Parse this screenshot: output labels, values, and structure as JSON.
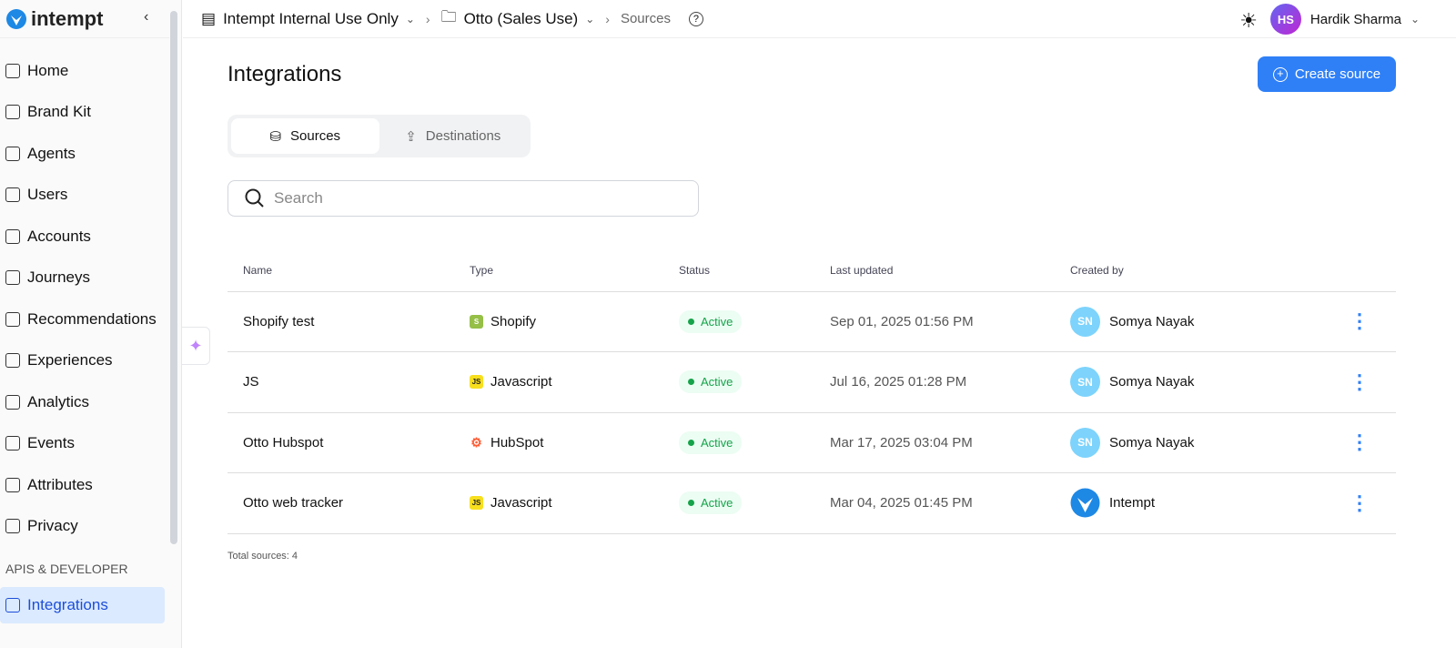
{
  "brand": "intempt",
  "sidebar": {
    "items": [
      {
        "label": "Home"
      },
      {
        "label": "Brand Kit"
      },
      {
        "label": "Agents"
      },
      {
        "label": "Users"
      },
      {
        "label": "Accounts"
      },
      {
        "label": "Journeys"
      },
      {
        "label": "Recommendations"
      },
      {
        "label": "Experiences"
      },
      {
        "label": "Analytics"
      },
      {
        "label": "Events"
      },
      {
        "label": "Attributes"
      },
      {
        "label": "Privacy"
      }
    ],
    "section": "APIS & DEVELOPER",
    "active": "Integrations"
  },
  "topbar": {
    "org": "Intempt Internal Use Only",
    "project": "Otto (Sales Use)",
    "page": "Sources",
    "user": {
      "initials": "HS",
      "name": "Hardik Sharma"
    }
  },
  "page": {
    "title": "Integrations",
    "create_label": "Create source",
    "tabs": [
      {
        "label": "Sources"
      },
      {
        "label": "Destinations"
      }
    ],
    "search_placeholder": "Search",
    "total": "Total sources: 4"
  },
  "table": {
    "headers": [
      "Name",
      "Type",
      "Status",
      "Last updated",
      "Created by"
    ],
    "rows": [
      {
        "name": "Shopify test",
        "type": "Shopify",
        "icon": "shopify-icon",
        "status": "Active",
        "updated": "Sep 01, 2025 01:56 PM",
        "creator": "Somya Nayak",
        "initials": "SN"
      },
      {
        "name": "JS",
        "type": "Javascript",
        "icon": "javascript-icon",
        "status": "Active",
        "updated": "Jul 16, 2025 01:28 PM",
        "creator": "Somya Nayak",
        "initials": "SN"
      },
      {
        "name": "Otto Hubspot",
        "type": "HubSpot",
        "icon": "hubspot-icon",
        "status": "Active",
        "updated": "Mar 17, 2025 03:04 PM",
        "creator": "Somya Nayak",
        "initials": "SN"
      },
      {
        "name": "Otto web tracker",
        "type": "Javascript",
        "icon": "javascript-icon",
        "status": "Active",
        "updated": "Mar 04, 2025 01:45 PM",
        "creator": "Intempt",
        "initials": ""
      }
    ]
  },
  "colors": {
    "accent": "#2f80f7",
    "active": "#16a34a"
  }
}
